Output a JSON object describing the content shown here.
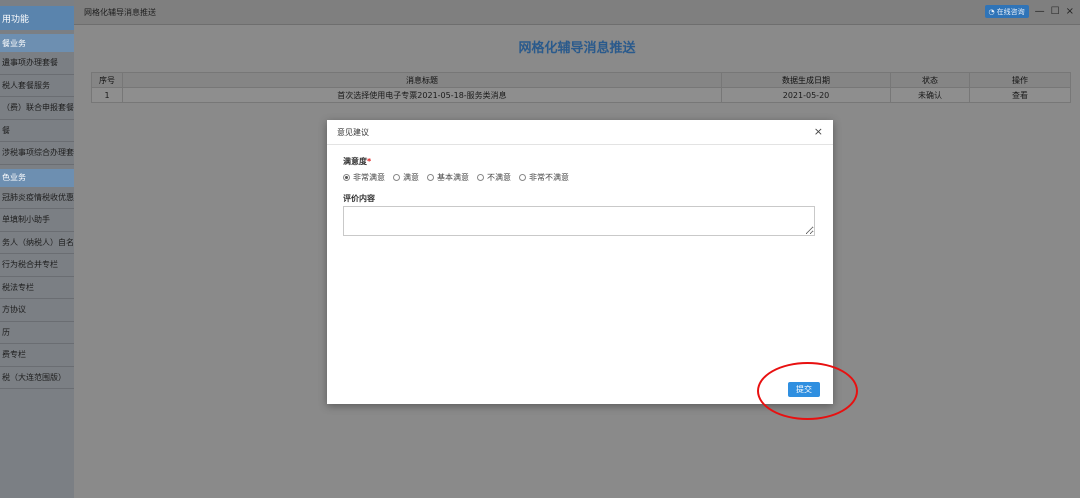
{
  "sidebar": {
    "header": "用功能",
    "sections": [
      {
        "title": "餐业务",
        "items": [
          "遺事项办理套餐",
          "税人套餐服务",
          "（费）联合申报套餐",
          "餐",
          "涉税事项综合办理套餐"
        ]
      },
      {
        "title": "色业务",
        "items": [
          "冠肺炎疫情税收优惠专",
          "单填制小助手",
          "务人（纳税人）自名册",
          "行为税合并专栏",
          "税法专栏",
          "方协议",
          "历",
          "费专栏",
          "税（大连范围版）"
        ]
      }
    ]
  },
  "window": {
    "title": "网格化辅导消息推送",
    "online_label": "在线咨询",
    "minimize": "—",
    "maximize": "☐",
    "close": "×"
  },
  "page_title": "网格化辅导消息推送",
  "table": {
    "headers": [
      "序号",
      "消息标题",
      "数据生成日期",
      "状态",
      "操作"
    ],
    "rows": [
      {
        "index": "1",
        "title": "首次选择使用电子专票2021-05-18-服务类消息",
        "date": "2021-05-20",
        "status": "未确认",
        "action": "查看"
      }
    ]
  },
  "modal": {
    "title": "意见建议",
    "close": "×",
    "satisfaction_label": "满意度",
    "required_mark": "*",
    "options": [
      {
        "label": "非常满意",
        "selected": true
      },
      {
        "label": "满意",
        "selected": false
      },
      {
        "label": "基本满意",
        "selected": false
      },
      {
        "label": "不满意",
        "selected": false
      },
      {
        "label": "非常不满意",
        "selected": false
      }
    ],
    "comment_label": "评价内容",
    "comment_value": "",
    "submit_label": "提交"
  },
  "colors": {
    "submit": "#2f8fe0",
    "annotation_circle": "#e81010",
    "page_title": "#2a5a8c"
  }
}
